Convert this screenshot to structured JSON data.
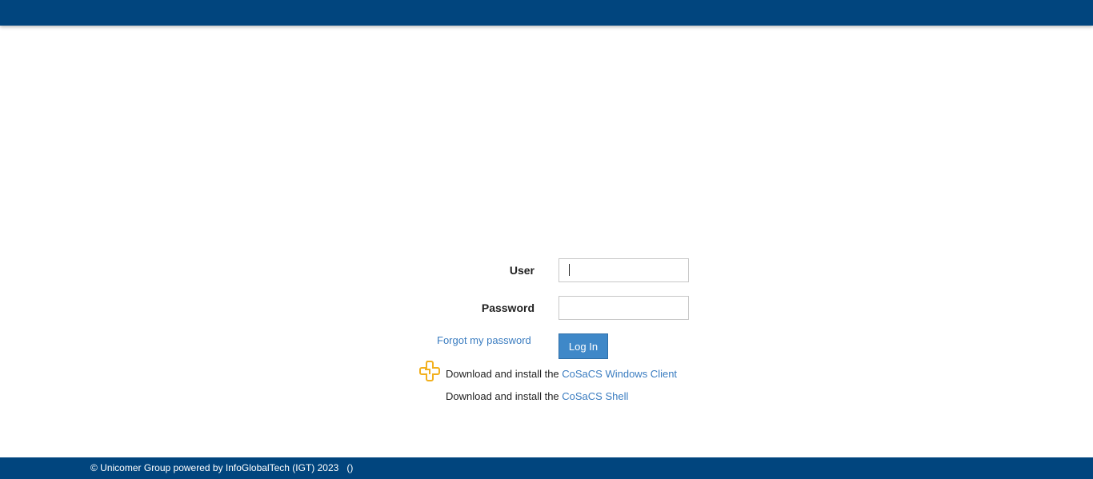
{
  "header": {},
  "login": {
    "user_label": "User",
    "user_value": "",
    "password_label": "Password",
    "password_value": "",
    "forgot_label": "Forgot my password",
    "login_button": "Log In"
  },
  "downloads": {
    "prefix": "Download and install the ",
    "windows_client_link": "CoSaCS Windows Client",
    "shell_link": "CoSaCS Shell",
    "logo_icon": "cosacs-logo-icon"
  },
  "footer": {
    "text": "© Unicomer Group powered by InfoGlobalTech (IGT) 2023   ()"
  },
  "colors": {
    "brand": "#01457e",
    "button": "#3f88c8",
    "link": "#3a7cc0",
    "logo": "#f2b01e"
  }
}
